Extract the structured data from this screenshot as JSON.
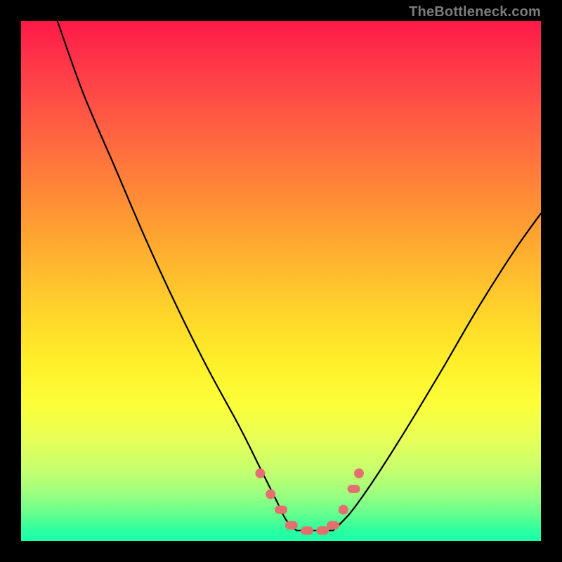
{
  "attribution": "TheBottleneck.com",
  "colors": {
    "gradient_top": "#ff1a47",
    "gradient_mid": "#ffd42a",
    "gradient_bottom": "#1affa9",
    "curve": "#000000",
    "markers": "#e46f6f",
    "frame": "#000000"
  },
  "chart_data": {
    "type": "line",
    "title": "",
    "xlabel": "",
    "ylabel": "",
    "xlim": [
      0,
      100
    ],
    "ylim": [
      0,
      100
    ],
    "grid": false,
    "series": [
      {
        "name": "left-branch",
        "x": [
          7,
          12,
          18,
          24,
          30,
          36,
          42,
          46,
          49,
          51,
          53
        ],
        "y": [
          100,
          86,
          72,
          58,
          45,
          33,
          22,
          14,
          8,
          4,
          2
        ]
      },
      {
        "name": "right-branch",
        "x": [
          60,
          63,
          66,
          70,
          75,
          81,
          88,
          95,
          100
        ],
        "y": [
          2,
          5,
          9,
          15,
          23,
          33,
          45,
          56,
          63
        ]
      },
      {
        "name": "flat-min",
        "x": [
          53,
          55,
          57,
          59,
          60
        ],
        "y": [
          2,
          2,
          2,
          2,
          2
        ]
      }
    ],
    "markers": {
      "name": "highlighted-points",
      "points": [
        {
          "x": 46,
          "y": 13,
          "shape": "dot"
        },
        {
          "x": 48,
          "y": 9,
          "shape": "dot"
        },
        {
          "x": 50,
          "y": 6,
          "shape": "pill"
        },
        {
          "x": 52,
          "y": 3,
          "shape": "pill"
        },
        {
          "x": 55,
          "y": 2,
          "shape": "pill"
        },
        {
          "x": 58,
          "y": 2,
          "shape": "pill"
        },
        {
          "x": 60,
          "y": 3,
          "shape": "pill"
        },
        {
          "x": 62,
          "y": 6,
          "shape": "dot"
        },
        {
          "x": 64,
          "y": 10,
          "shape": "pill"
        },
        {
          "x": 65,
          "y": 13,
          "shape": "dot"
        }
      ]
    }
  }
}
